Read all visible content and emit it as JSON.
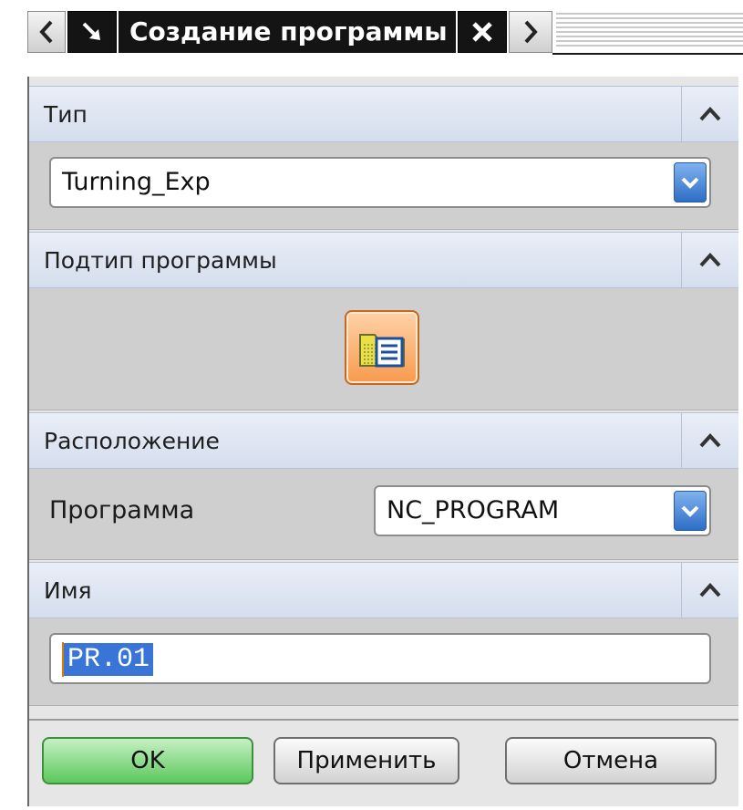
{
  "window": {
    "title": "Создание программы"
  },
  "sections": {
    "type": {
      "title": "Тип",
      "combo_value": "Turning_Exp"
    },
    "subtype": {
      "title": "Подтип программы"
    },
    "location": {
      "title": "Расположение",
      "program_label": "Программа",
      "program_value": "NC_PROGRAM"
    },
    "name": {
      "title": "Имя",
      "value": "PR.01"
    }
  },
  "buttons": {
    "ok": "OK",
    "apply": "Применить",
    "cancel": "Отмена"
  },
  "icons": {
    "back": "chevron-left-icon",
    "pin": "arrow-down-right-icon",
    "close": "close-icon",
    "forward": "chevron-right-icon",
    "collapse": "chevron-up-icon",
    "dropdown": "chevron-down-icon",
    "subtype": "program-folder-icon"
  },
  "colors": {
    "header_bg": "#d5deee",
    "body_bg": "#cfcfcf",
    "ok_button": "#5cc85c",
    "selection": "#3875d7",
    "subtype_button": "#f79a4e"
  }
}
